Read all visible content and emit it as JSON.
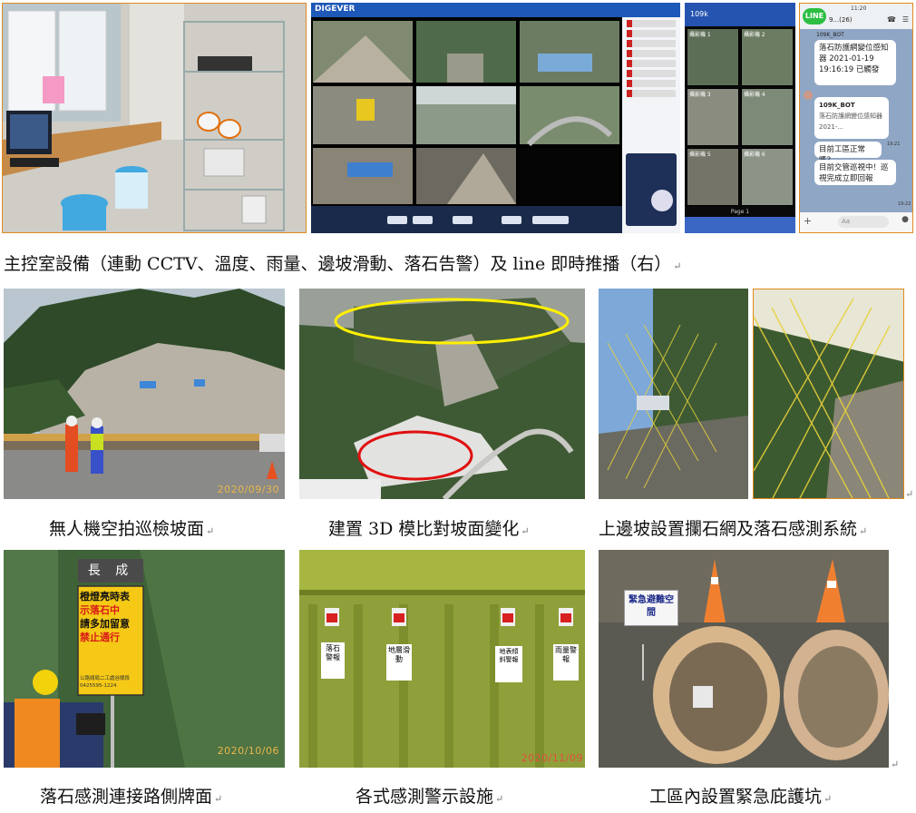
{
  "captions": {
    "row0": "主控室設備（連動 CCTV、溫度、雨量、邊坡滑動、落石告警）及 line 即時推播（右）",
    "drone": "無人機空拍巡檢坡面",
    "model3d": "建置 3D 模比對坡面變化",
    "net": "上邊坡設置攔石網及落石感測系統",
    "sign": "落石感測連接路側牌面",
    "alarms": "各式感測警示設施",
    "pit": "工區內設置緊急庇護坑"
  },
  "paragraph_mark": "↵",
  "stamps": {
    "drone": "2020/09/30",
    "sign": "2020/10/06",
    "alarms": "2020/11/09"
  },
  "cctv": {
    "brand": "DIGEVER"
  },
  "app": {
    "title": "109k",
    "tiles": [
      "攝影機 1",
      "攝影機 2",
      "攝影機 3",
      "攝影機 4",
      "攝影機 5",
      "攝影機 6"
    ],
    "page": "Page 1"
  },
  "line": {
    "logo": "LINE",
    "status_time": "11:20",
    "chat_count": "9...(26)",
    "bot_name": "109K_BOT",
    "msg1": "落石防護網變位感知器 2021-01-19 19:16:19 已觸發",
    "msg2_title": "109K_BOT",
    "msg2": "落石防護網變位感知器 2021-...",
    "msg3": "目前工區正常嗎？",
    "msg3_time": "19:21",
    "msg4": "目前交管巡視中！巡視完成立即回報",
    "msg4_time": "19:22",
    "input_placeholder": "Aa"
  },
  "sign": {
    "place": "長 成",
    "lines": [
      "橙燈亮時表",
      "示落石中",
      "請多加留意",
      "禁止通行"
    ],
    "org": "公路總局二工處谷關段",
    "phone": "0425595-1224"
  },
  "alarms": {
    "labels": [
      "落石警報",
      "地層滑動",
      "地表傾斜警報",
      "雨量警報"
    ]
  },
  "pit": {
    "sign": "緊急避難空間"
  },
  "colors": {
    "frame": "#e08a1e",
    "ellipse_yellow": "#ffef00",
    "ellipse_red": "#e01010",
    "net_yellow": "#e8d23a"
  }
}
